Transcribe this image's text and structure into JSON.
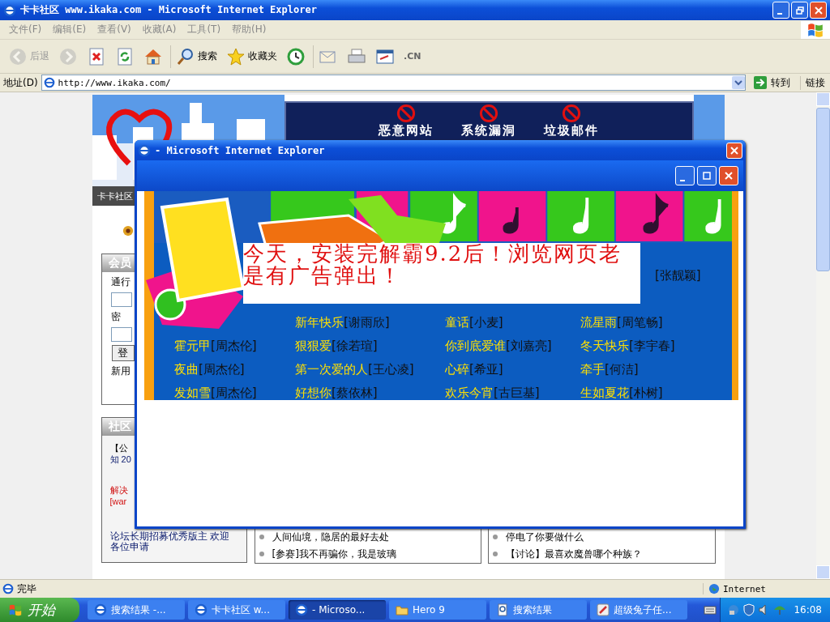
{
  "browser": {
    "title": "卡卡社区 www.ikaka.com - Microsoft Internet Explorer",
    "menu": [
      "文件(F)",
      "编辑(E)",
      "查看(V)",
      "收藏(A)",
      "工具(T)",
      "帮助(H)"
    ],
    "toolbar": [
      {
        "kind": "back",
        "label": "后退",
        "disabled": true
      },
      {
        "kind": "forward",
        "disabled": true
      },
      {
        "kind": "stop",
        "disabled": false
      },
      {
        "kind": "refresh",
        "disabled": false
      },
      {
        "kind": "home",
        "disabled": false
      },
      {
        "kind": "search",
        "label": "搜索",
        "disabled": false
      },
      {
        "kind": "favorites",
        "label": "收藏夹",
        "disabled": false
      },
      {
        "kind": "history",
        "disabled": false
      },
      {
        "kind": "mail",
        "disabled": false
      },
      {
        "kind": "print",
        "disabled": false
      },
      {
        "kind": "edit",
        "disabled": false
      },
      {
        "kind": "cn",
        "label": ".CN",
        "disabled": false
      }
    ],
    "address_label": "地址(D)",
    "url": "http://www.ikaka.com/",
    "go": "转到",
    "links": "链接",
    "status": "完毕",
    "zone": "Internet"
  },
  "page": {
    "banner": [
      "恶意网站",
      "系统漏洞",
      "垃圾邮件"
    ],
    "nav": "卡卡社区",
    "member": {
      "title": "会员",
      "user_label": "通行",
      "password_label": "密",
      "login": "登",
      "new_user": "新用"
    },
    "community": {
      "title": "社区",
      "items": [
        {
          "text": "【公",
          "kind": "notice"
        },
        {
          "text": "知 20",
          "kind": "link"
        },
        {
          "text": "解决",
          "kind": "alert"
        },
        {
          "text": "[war",
          "kind": "alert"
        },
        {
          "text": "论坛长期招募优秀版主 欢迎各位申请",
          "kind": "link"
        }
      ]
    },
    "lists": [
      [
        "人间仙境，隐居的最好去处",
        "[参赛]我不再骗你，我是玻璃"
      ],
      [
        "停电了你要做什么",
        "【讨论】最喜欢魔兽哪个种族？"
      ]
    ]
  },
  "popup": {
    "title": "- Microsoft Internet Explorer",
    "song_rows": [
      [
        null,
        null,
        null,
        {
          "artist": "[张靓颖]"
        }
      ],
      [
        null,
        {
          "title": "新年快乐",
          "artist": "[谢雨欣]"
        },
        {
          "title": "童话",
          "artist": "[小麦]"
        },
        {
          "title": "流星雨",
          "artist": "[周笔畅]"
        }
      ],
      [
        {
          "title": "霍元甲",
          "artist": "[周杰伦]"
        },
        {
          "title": "狠狠爱",
          "artist": "[徐若瑄]"
        },
        {
          "title": "你到底爱谁",
          "artist": "[刘嘉亮]"
        },
        {
          "title": "冬天快乐",
          "artist": "[李宇春]"
        }
      ],
      [
        {
          "title": "夜曲",
          "artist": "[周杰伦]"
        },
        {
          "title": "第一次爱的人",
          "artist": "[王心凌]"
        },
        {
          "title": "心碎",
          "artist": "[希亚]"
        },
        {
          "title": "牵手",
          "artist": "[何洁]"
        }
      ],
      [
        {
          "title": "发如雪",
          "artist": "[周杰伦]"
        },
        {
          "title": "好想你",
          "artist": "[蔡依林]"
        },
        {
          "title": "欢乐今宵",
          "artist": "[古巨基]"
        },
        {
          "title": "生如夏花",
          "artist": "[朴树]"
        }
      ]
    ],
    "ad_text": "今天，安装完解霸9.2后！浏览网页老是有广告弹出！"
  },
  "taskbar": {
    "start": "开始",
    "tasks": [
      {
        "label": "搜索结果 -...",
        "kind": "ie",
        "selected": false
      },
      {
        "label": "卡卡社区 w...",
        "kind": "ie",
        "selected": false
      },
      {
        "label": "- Microso...",
        "kind": "ie",
        "selected": true
      },
      {
        "label": "Hero 9",
        "kind": "folder",
        "selected": false
      },
      {
        "label": "搜索结果",
        "kind": "doc",
        "selected": false
      },
      {
        "label": "超级兔子任...",
        "kind": "app",
        "selected": false
      }
    ],
    "clock": "16:08"
  }
}
